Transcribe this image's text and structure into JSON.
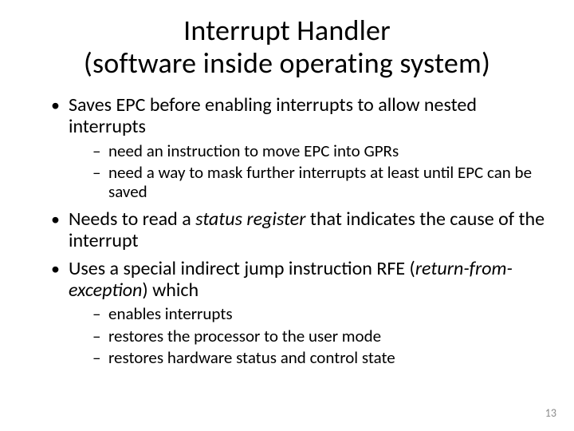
{
  "title_line1": "Interrupt Handler",
  "title_line2": "(software inside operating system)",
  "bullets": [
    {
      "runs": [
        {
          "t": "Saves EPC before enabling interrupts to allow nested interrupts",
          "i": false
        }
      ],
      "sub": [
        "need an instruction to move EPC into GPRs",
        "need a way to mask further interrupts at least until EPC can be saved"
      ]
    },
    {
      "runs": [
        {
          "t": "Needs to read a ",
          "i": false
        },
        {
          "t": "status register",
          "i": true
        },
        {
          "t": " that indicates the cause of the interrupt",
          "i": false
        }
      ],
      "sub": []
    },
    {
      "runs": [
        {
          "t": "Uses a special indirect jump instruction RFE (",
          "i": false
        },
        {
          "t": "return-from-exception",
          "i": true
        },
        {
          "t": ") which",
          "i": false
        }
      ],
      "sub": [
        "enables interrupts",
        "restores the processor to the user mode",
        "restores hardware status and control state"
      ]
    }
  ],
  "page_number": "13"
}
